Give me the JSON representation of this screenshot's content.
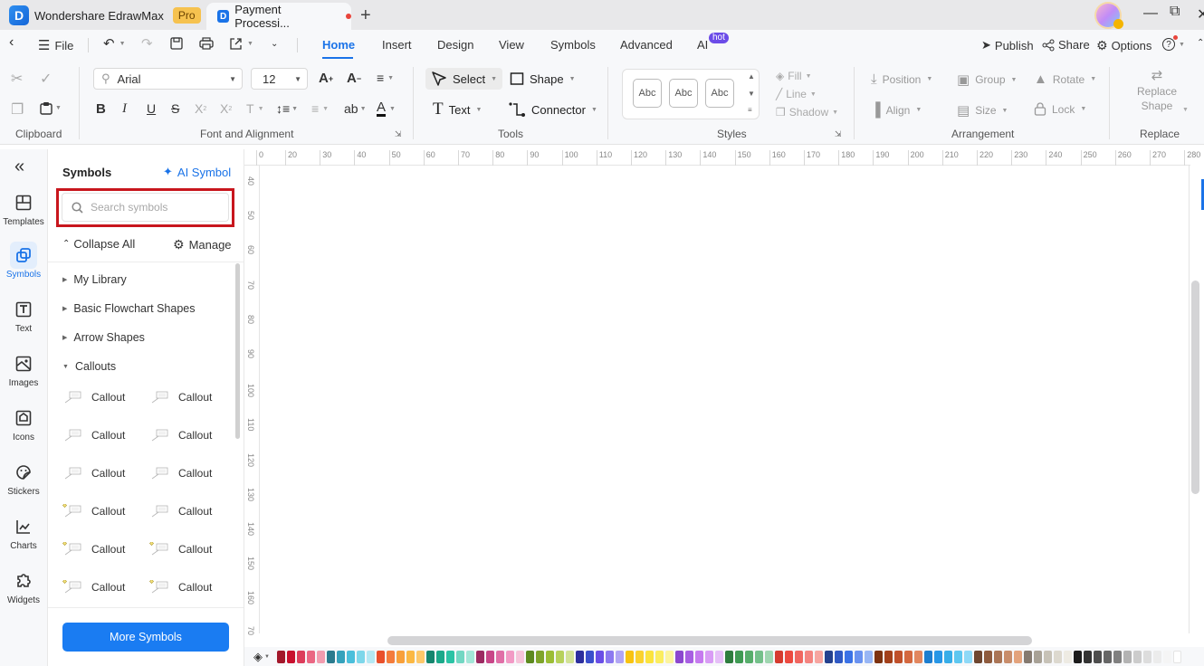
{
  "titlebar": {
    "app_name": "Wondershare EdrawMax",
    "badge": "Pro",
    "document_tab": "Payment Processi...",
    "new_tab": "+"
  },
  "menubar": {
    "file": "File",
    "tabs": [
      "Home",
      "Insert",
      "Design",
      "View",
      "Symbols",
      "Advanced",
      "AI"
    ],
    "active_tab": "Home",
    "hot_badge": "hot",
    "publish": "Publish",
    "share": "Share",
    "options": "Options"
  },
  "ribbon": {
    "clipboard_label": "Clipboard",
    "font": {
      "family": "Arial",
      "size": "12",
      "group_label": "Font and Alignment"
    },
    "tools": {
      "select": "Select",
      "shape": "Shape",
      "text": "Text",
      "connector": "Connector",
      "group_label": "Tools"
    },
    "styles": {
      "sample": "Abc",
      "fill": "Fill",
      "line": "Line",
      "shadow": "Shadow",
      "group_label": "Styles"
    },
    "arrangement": {
      "position": "Position",
      "group": "Group",
      "rotate": "Rotate",
      "align": "Align",
      "size": "Size",
      "lock": "Lock",
      "group_label": "Arrangement"
    },
    "replace": {
      "line1": "Replace",
      "line2": "Shape",
      "group_label": "Replace"
    }
  },
  "leftnav": {
    "items": [
      "Templates",
      "Symbols",
      "Text",
      "Images",
      "Icons",
      "Stickers",
      "Charts",
      "Widgets"
    ],
    "active": "Symbols"
  },
  "symbols_panel": {
    "title": "Symbols",
    "ai_symbol": "AI Symbol",
    "search_placeholder": "Search symbols",
    "collapse_all": "Collapse All",
    "manage": "Manage",
    "categories": [
      {
        "label": "My Library",
        "expanded": false
      },
      {
        "label": "Basic Flowchart Shapes",
        "expanded": false
      },
      {
        "label": "Arrow Shapes",
        "expanded": false
      },
      {
        "label": "Callouts",
        "expanded": true
      }
    ],
    "callout_items": [
      "Callout",
      "Callout",
      "Callout",
      "Callout",
      "Callout",
      "Callout",
      "Callout",
      "Callout",
      "Callout",
      "Callout",
      "Callout",
      "Callout"
    ],
    "more_symbols": "More Symbols"
  },
  "rulers": {
    "horizontal": [
      "0",
      "20",
      "30",
      "40",
      "50",
      "60",
      "70",
      "80",
      "90",
      "100",
      "110",
      "120",
      "130",
      "140",
      "150",
      "160",
      "170",
      "180",
      "190",
      "200",
      "210",
      "220",
      "230",
      "240",
      "250",
      "260",
      "270",
      "280"
    ],
    "vertical": [
      "40",
      "50",
      "60",
      "70",
      "80",
      "90",
      "100",
      "110",
      "120",
      "130",
      "140",
      "150",
      "160",
      "70"
    ]
  },
  "palette": {
    "colors": [
      "#a3182b",
      "#c8102e",
      "#dc3d5b",
      "#ea6783",
      "#f29caf",
      "#2a7b8e",
      "#35a2bc",
      "#4bbfdb",
      "#7ed7ea",
      "#b4e8f3",
      "#e9502c",
      "#f47c3c",
      "#f8a03a",
      "#fbb843",
      "#fdc86a",
      "#14866e",
      "#1ba98a",
      "#2bc3a5",
      "#72d7c3",
      "#a3e6d8",
      "#9c2a62",
      "#c84688",
      "#e06fa7",
      "#f29ac5",
      "#f6c4da",
      "#5d8a1f",
      "#7ea42a",
      "#9bbd35",
      "#b7d15c",
      "#d2e296",
      "#2d2f9e",
      "#3b4fcc",
      "#6a4ee6",
      "#8c79f0",
      "#b1a5f4",
      "#f8c310",
      "#fad22e",
      "#fbe33e",
      "#fbed5f",
      "#fcf49d",
      "#8c47cf",
      "#a85ee2",
      "#c67aef",
      "#d99cf5",
      "#e6bff8",
      "#2e7d3e",
      "#3f9a53",
      "#57ad6b",
      "#74c08a",
      "#9fd6b0",
      "#d63b2f",
      "#ec4a40",
      "#f06660",
      "#f48480",
      "#f7a5a0",
      "#24418f",
      "#2f59c4",
      "#3b72e6",
      "#6a92f0",
      "#98b6f5",
      "#7d3210",
      "#a3401a",
      "#c0502a",
      "#d4683f",
      "#e2875f",
      "#1d7ed0",
      "#2796e6",
      "#37ade8",
      "#5ec7f0",
      "#8ed9f7",
      "#6e4630",
      "#8e5b3e",
      "#aa7556",
      "#c88d6b",
      "#e3a37c",
      "#857a70",
      "#a8a196",
      "#c7c2b7",
      "#ddd9cf",
      "#eeebe3",
      "#1c1c1c",
      "#333333",
      "#4d4d4d",
      "#666666",
      "#808080",
      "#b3b3b3",
      "#cccccc",
      "#dddddd",
      "#ececec",
      "#f5f5f5",
      "#ffffff"
    ]
  }
}
